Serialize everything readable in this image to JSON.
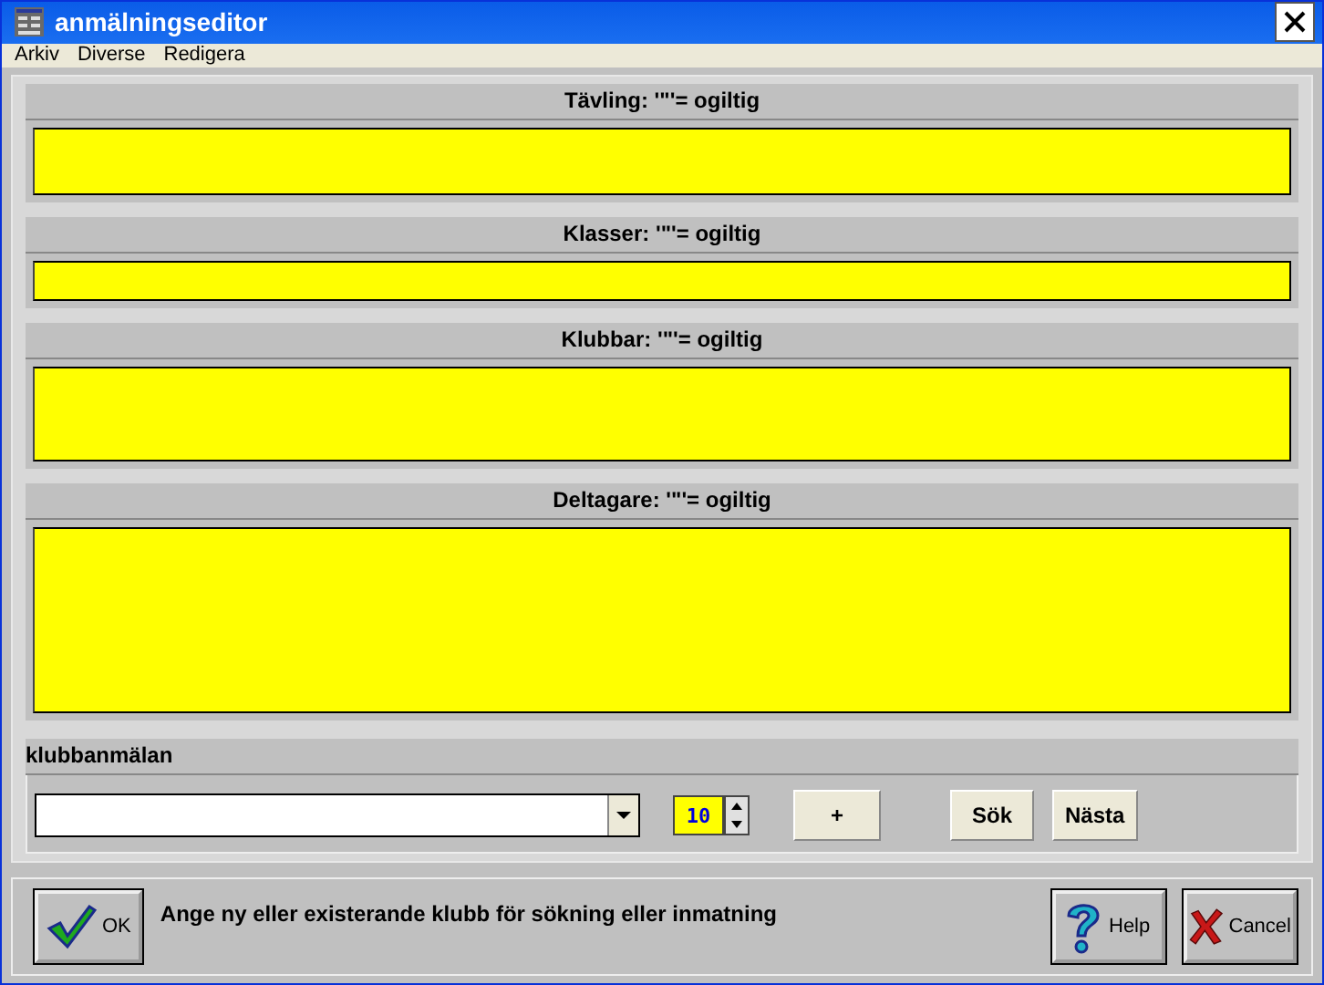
{
  "window": {
    "title": "anmälningseditor"
  },
  "menu": [
    "Arkiv",
    "Diverse",
    "Redigera"
  ],
  "sections": [
    {
      "label": "Tävling: '\"'= ogiltig"
    },
    {
      "label": "Klasser: '\"'= ogiltig"
    },
    {
      "label": "Klubbar: '\"'= ogiltig"
    },
    {
      "label": "Deltagare: '\"'= ogiltig"
    }
  ],
  "club_entry": {
    "title": "klubbanmälan",
    "count": "10",
    "add_button": "+",
    "search_button": "Sök",
    "next_button": "Nästa"
  },
  "footer": {
    "ok_button": "OK",
    "message": "Ange ny eller existerande klubb för sökning eller inmatning",
    "help_button": "Help",
    "cancel_button": "Cancel"
  }
}
